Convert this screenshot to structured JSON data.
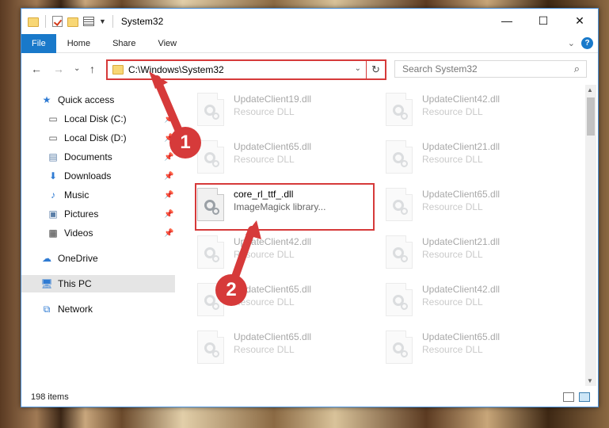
{
  "window": {
    "title": "System32",
    "controls": {
      "minimize": "—",
      "maximize": "☐",
      "close": "✕"
    }
  },
  "ribbon": {
    "tabs": [
      "File",
      "Home",
      "Share",
      "View"
    ],
    "help": "?",
    "collapse": "⌄"
  },
  "navigation": {
    "back": "←",
    "forward": "→",
    "recent": "⌄",
    "up": "↑"
  },
  "address": {
    "path": "C:\\Windows\\System32",
    "dropdown": "⌄",
    "refresh": "↻"
  },
  "search": {
    "placeholder": "Search System32",
    "icon": "⌕"
  },
  "sidebar": {
    "items": [
      {
        "label": "Quick access",
        "icon": "star-icon",
        "pinned": false
      },
      {
        "label": "Local Disk (C:)",
        "icon": "drive-icon",
        "pinned": true
      },
      {
        "label": "Local Disk (D:)",
        "icon": "drive-icon",
        "pinned": true
      },
      {
        "label": "Documents",
        "icon": "documents-icon",
        "pinned": true
      },
      {
        "label": "Downloads",
        "icon": "download-icon",
        "pinned": true
      },
      {
        "label": "Music",
        "icon": "music-icon",
        "pinned": true
      },
      {
        "label": "Pictures",
        "icon": "pictures-icon",
        "pinned": true
      },
      {
        "label": "Videos",
        "icon": "videos-icon",
        "pinned": true
      },
      {
        "label": "OneDrive",
        "icon": "cloud-icon",
        "pinned": false
      },
      {
        "label": "This PC",
        "icon": "computer-icon",
        "pinned": false,
        "selected": true
      },
      {
        "label": "Network",
        "icon": "network-icon",
        "pinned": false
      }
    ]
  },
  "files": [
    {
      "name": "UpdateClient19.dll",
      "desc": "Resource DLL",
      "faded": true
    },
    {
      "name": "UpdateClient42.dll",
      "desc": "Resource DLL",
      "faded": true
    },
    {
      "name": "UpdateClient65.dll",
      "desc": "Resource DLL",
      "faded": true
    },
    {
      "name": "UpdateClient21.dll",
      "desc": "Resource DLL",
      "faded": true
    },
    {
      "name": "core_rl_ttf_.dll",
      "desc": "ImageMagick library...",
      "faded": false
    },
    {
      "name": "UpdateClient65.dll",
      "desc": "Resource DLL",
      "faded": true
    },
    {
      "name": "UpdateClient42.dll",
      "desc": "Resource DLL",
      "faded": true
    },
    {
      "name": "UpdateClient21.dll",
      "desc": "Resource DLL",
      "faded": true
    },
    {
      "name": "UpdateClient65.dll",
      "desc": "Resource DLL",
      "faded": true
    },
    {
      "name": "UpdateClient42.dll",
      "desc": "Resource DLL",
      "faded": true
    },
    {
      "name": "UpdateClient65.dll",
      "desc": "Resource DLL",
      "faded": true
    },
    {
      "name": "UpdateClient65.dll",
      "desc": "Resource DLL",
      "faded": true
    }
  ],
  "status": {
    "item_count": "198 items"
  },
  "annotations": {
    "step1": "1",
    "step2": "2",
    "color": "#d63a3a"
  }
}
